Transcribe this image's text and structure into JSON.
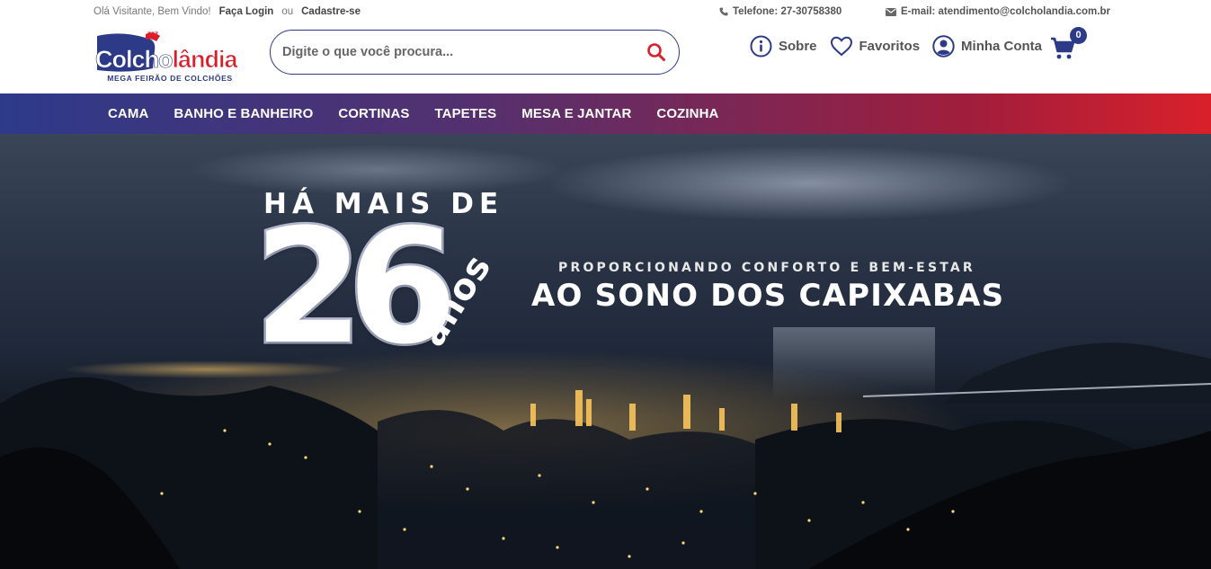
{
  "topbar": {
    "welcome": "Olá Visitante, Bem Vindo!",
    "login": "Faça Login",
    "or": "ou",
    "register": "Cadastre-se",
    "phone": "Telefone: 27-30758380",
    "email": "E-mail: atendimento@colcholandia.com.br"
  },
  "logo": {
    "name_part1": "Colcho",
    "name_part2": "lândia",
    "tagline": "MEGA FEIRÃO DE COLCHÕES",
    "sleep_mark": "zzz"
  },
  "search": {
    "placeholder": "Digite o que você procura..."
  },
  "actions": {
    "about": "Sobre",
    "favorites": "Favoritos",
    "account": "Minha Conta",
    "cart_count": "0"
  },
  "nav": {
    "items": [
      "CAMA",
      "BANHO E BANHEIRO",
      "CORTINAS",
      "TAPETES",
      "MESA E JANTAR",
      "COZINHA"
    ]
  },
  "hero": {
    "lead": "HÁ MAIS DE",
    "number": "26",
    "unit": "anos",
    "subtitle": "PROPORCIONANDO CONFORTO E BEM-ESTAR",
    "title": "AO SONO DOS CAPIXABAS"
  },
  "colors": {
    "brand_blue": "#2d3a87",
    "brand_red": "#d9202a"
  }
}
